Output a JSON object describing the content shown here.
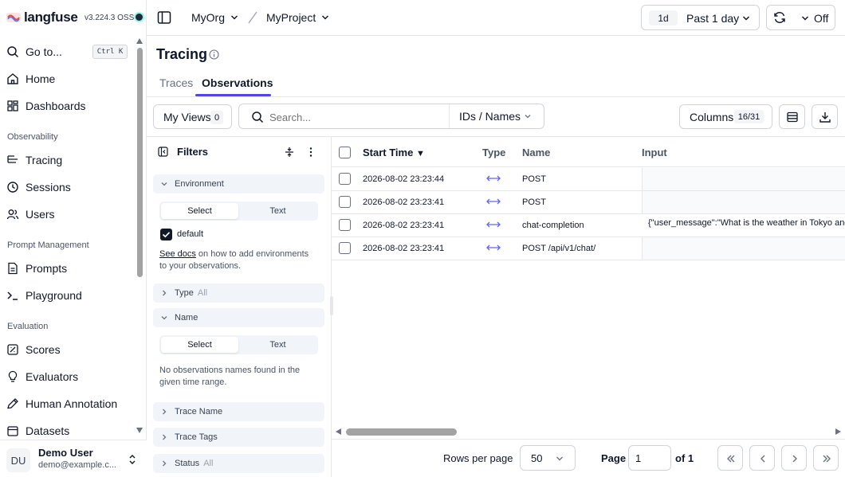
{
  "app": {
    "brand": "langfuse",
    "version": "v3.224.3 OSS"
  },
  "sidebar": {
    "goto_label": "Go to...",
    "goto_shortcut": "Ctrl K",
    "home": "Home",
    "dashboards": "Dashboards",
    "section_observability": "Observability",
    "tracing": "Tracing",
    "sessions": "Sessions",
    "users": "Users",
    "section_prompt": "Prompt Management",
    "prompts": "Prompts",
    "playground": "Playground",
    "section_evaluation": "Evaluation",
    "scores": "Scores",
    "evaluators": "Evaluators",
    "human_annotation": "Human Annotation",
    "datasets": "Datasets",
    "user": {
      "initials": "DU",
      "name": "Demo User",
      "email": "demo@example.c..."
    }
  },
  "topbar": {
    "org": "MyOrg",
    "project": "MyProject",
    "range_short": "1d",
    "range_label": "Past 1 day",
    "refresh_label": "Off"
  },
  "page": {
    "title": "Tracing",
    "tabs": [
      "Traces",
      "Observations"
    ],
    "active_tab": "Observations"
  },
  "toolbar": {
    "my_views": "My Views",
    "my_views_count": "0",
    "search_placeholder": "Search...",
    "search_mode": "IDs / Names",
    "columns_label": "Columns",
    "columns_count": "16/31"
  },
  "filters": {
    "title": "Filters",
    "environment": "Environment",
    "select": "Select",
    "text": "Text",
    "env_value": "default",
    "env_help_link": "See docs",
    "env_help_rest": " on how to add environments",
    "env_help_line2": "to your observations.",
    "type": "Type",
    "type_value": "All",
    "name": "Name",
    "name_empty_line1": "No observations names found in the",
    "name_empty_line2": "given time range.",
    "trace_name": "Trace Name",
    "trace_tags": "Trace Tags",
    "status": "Status",
    "status_value": "All"
  },
  "table": {
    "columns": [
      "Start Time",
      "Type",
      "Name",
      "Input"
    ],
    "rows": [
      {
        "start_time": "2026-08-02 23:23:44",
        "name": "POST",
        "input": ""
      },
      {
        "start_time": "2026-08-02 23:23:41",
        "name": "POST",
        "input": ""
      },
      {
        "start_time": "2026-08-02 23:23:41",
        "name": "chat-completion",
        "input": "{\"user_message\":\"What is the weather in Tokyo and"
      },
      {
        "start_time": "2026-08-02 23:23:41",
        "name": "POST /api/v1/chat/",
        "input": ""
      }
    ]
  },
  "pagination": {
    "rows_per_page_label": "Rows per page",
    "rows_per_page": "50",
    "page_label": "Page",
    "page_value": "1",
    "of_label": "of 1"
  },
  "colors": {
    "accent": "#4f46e5",
    "type_icon": "#6366f1"
  }
}
